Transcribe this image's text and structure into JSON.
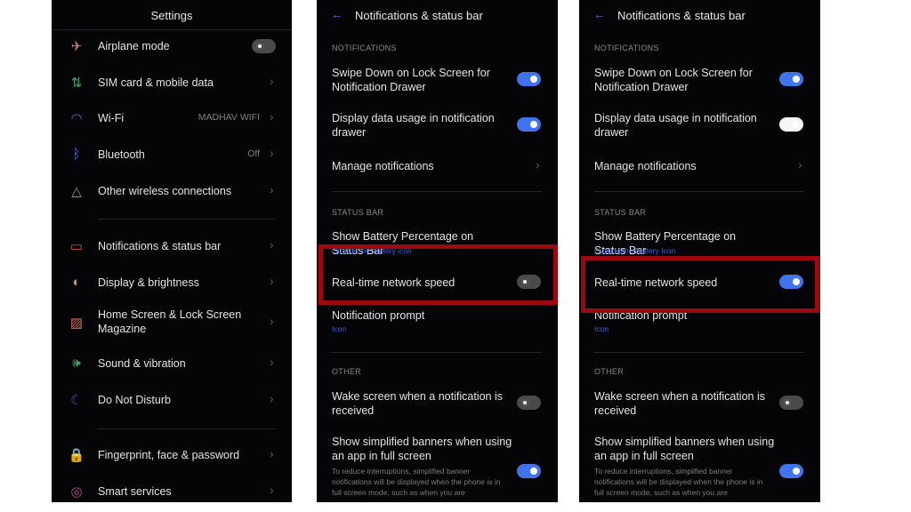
{
  "settings": {
    "title": "Settings",
    "items": [
      {
        "label": "Airplane mode",
        "icon": "airplane-icon",
        "color": "#e0784a",
        "control": "toggle-off"
      },
      {
        "label": "SIM card & mobile data",
        "icon": "mobile-data-icon",
        "color": "#3fae6a",
        "control": "chevron"
      },
      {
        "label": "Wi-Fi",
        "icon": "wifi-icon",
        "color": "#4a6ee0",
        "value": "MADHAV WIFI",
        "control": "chevron"
      },
      {
        "label": "Bluetooth",
        "icon": "bluetooth-icon",
        "color": "#4a6ee0",
        "value": "Off",
        "control": "chevron"
      },
      {
        "label": "Other wireless connections",
        "icon": "wireless-connections-icon",
        "color": "#9a9a9a",
        "control": "chevron"
      },
      {
        "label": "Notifications & status bar",
        "icon": "notification-icon",
        "color": "#d05050",
        "control": "chevron"
      },
      {
        "label": "Display & brightness",
        "icon": "display-brightness-icon",
        "color": "#e08a5a",
        "control": "chevron"
      },
      {
        "label": "Home Screen & Lock Screen Magazine",
        "icon": "wallpaper-icon",
        "color": "#d0705a",
        "control": "chevron"
      },
      {
        "label": "Sound & vibration",
        "icon": "speaker-icon",
        "color": "#4aa05a",
        "control": "chevron"
      },
      {
        "label": "Do Not Disturb",
        "icon": "moon-icon",
        "color": "#5a4ac0",
        "control": "chevron"
      },
      {
        "label": "Fingerprint, face & password",
        "icon": "lock-icon",
        "color": "#4a6ee0",
        "control": "chevron"
      },
      {
        "label": "Smart services",
        "icon": "smart-services-icon",
        "color": "#c04a8a",
        "control": "chevron"
      }
    ]
  },
  "notif_before": {
    "title": "Notifications & status bar",
    "sections": {
      "notifications": "NOTIFICATIONS",
      "status_bar": "STATUS BAR",
      "other": "OTHER"
    },
    "items": [
      {
        "label": "Swipe Down on Lock Screen for Notification Drawer",
        "control": "on"
      },
      {
        "label": "Display data usage in notification drawer",
        "control": "on"
      },
      {
        "label": "Manage notifications",
        "control": "chevron"
      },
      {
        "label": "Show Battery Percentage on Status Bar",
        "sub": "Outside the battery icon"
      },
      {
        "label": "Real-time network speed",
        "control": "off"
      },
      {
        "label": "Notification prompt",
        "sub": "Icon"
      },
      {
        "label": "Wake screen when a notification is received",
        "control": "off"
      },
      {
        "label": "Show simplified banners when using an app in full screen",
        "desc": "To reduce interruptions, simplified banner notifications will be displayed when the phone is in full screen mode, such as when you are",
        "control": "on"
      }
    ]
  },
  "notif_after": {
    "title": "Notifications & status bar",
    "sections": {
      "notifications": "NOTIFICATIONS",
      "status_bar": "STATUS BAR",
      "other": "OTHER"
    },
    "items": [
      {
        "label": "Swipe Down on Lock Screen for Notification Drawer",
        "control": "on"
      },
      {
        "label": "Display data usage in notification drawer",
        "control": "white"
      },
      {
        "label": "Manage notifications",
        "control": "chevron"
      },
      {
        "label": "Show Battery Percentage on Status Bar",
        "sub": "Outside the Battery Icon"
      },
      {
        "label": "Real-time network speed",
        "control": "on"
      },
      {
        "label": "Notification prompt",
        "sub": "Icon"
      },
      {
        "label": "Wake screen when a notification is received",
        "control": "off"
      },
      {
        "label": "Show simplified banners when using an app in full screen",
        "desc": "To reduce interruptions, simplified banner notifications will be displayed when the phone is in full screen mode, such as when you are",
        "control": "on"
      }
    ]
  },
  "highlight_color": "#9c0a10"
}
